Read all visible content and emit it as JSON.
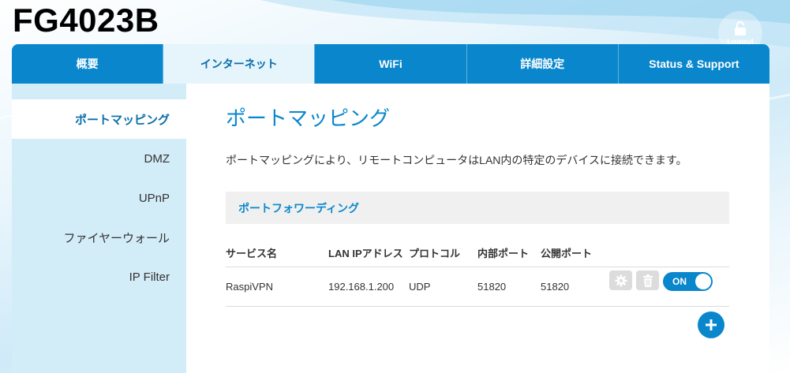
{
  "header": {
    "device_title": "FG4023B",
    "logout_label": "Logout"
  },
  "nav": {
    "tabs": [
      {
        "label": "概要"
      },
      {
        "label": "インターネット",
        "active": true
      },
      {
        "label": "WiFi"
      },
      {
        "label": "詳細設定"
      },
      {
        "label": "Status & Support"
      }
    ]
  },
  "sidebar": {
    "items": [
      {
        "label": "ポートマッピング",
        "active": true
      },
      {
        "label": "DMZ"
      },
      {
        "label": "UPnP"
      },
      {
        "label": "ファイヤーウォール"
      },
      {
        "label": "IP Filter"
      }
    ]
  },
  "main": {
    "title": "ポートマッピング",
    "description": "ポートマッピングにより、リモートコンピュータはLAN内の特定のデバイスに接続できます。",
    "section_title": "ポートフォワーディング",
    "table": {
      "headers": {
        "service": "サービス名",
        "lan_ip": "LAN IPアドレス",
        "protocol": "プロトコル",
        "internal_port": "内部ポート",
        "public_port": "公開ポート"
      },
      "rows": [
        {
          "service": "RaspiVPN",
          "lan_ip": "192.168.1.200",
          "protocol": "UDP",
          "internal_port": "51820",
          "public_port": "51820",
          "toggle_label": "ON"
        }
      ]
    }
  },
  "icons": {
    "logout": "unlock-icon",
    "settings": "gear-icon",
    "delete": "trash-icon",
    "add": "plus-icon"
  },
  "colors": {
    "accent": "#0a87cc",
    "sidebar_bg": "#d2ecf8",
    "button_gray": "#dcdcdc"
  }
}
